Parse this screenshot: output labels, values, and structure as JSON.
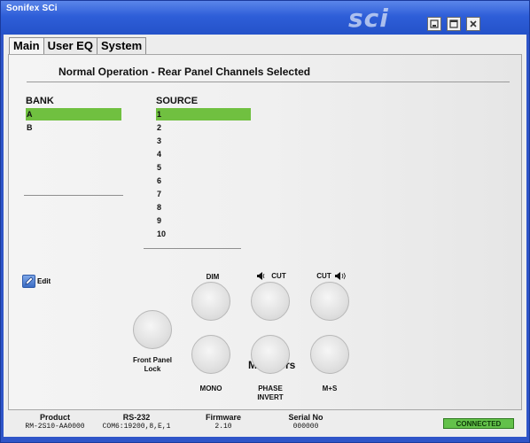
{
  "window": {
    "title": "Sonifex SCi",
    "logo_text": "sci",
    "minimize_label": "",
    "restore_label": "",
    "close_label": ""
  },
  "tabs": [
    {
      "label": "Main",
      "active": true
    },
    {
      "label": "User EQ",
      "active": false
    },
    {
      "label": "System",
      "active": false
    }
  ],
  "main": {
    "heading": "Normal Operation - Rear Panel Channels Selected",
    "bank": {
      "label": "BANK",
      "items": [
        "A",
        "B"
      ],
      "selected": "A"
    },
    "source": {
      "label": "SOURCE",
      "items": [
        "1",
        "2",
        "3",
        "4",
        "5",
        "6",
        "7",
        "8",
        "9",
        "10"
      ],
      "selected": "1"
    },
    "edit_label": "Edit",
    "buttons": {
      "front_panel_lock": "Front Panel Lock",
      "front_panel_lock_line1": "Front Panel",
      "front_panel_lock_line2": "Lock",
      "dim": "DIM",
      "cut_left": "CUT",
      "cut_right": "CUT",
      "mono": "MONO",
      "phase_invert_line1": "PHASE",
      "phase_invert_line2": "INVERT",
      "ms": "M+S"
    },
    "modifiers_label": "Modifiers"
  },
  "status": {
    "product_label": "Product",
    "product_value": "RM-2S10-AA0000",
    "rs232_label": "RS-232",
    "rs232_value": "COM6:19200,8,E,1",
    "firmware_label": "Firmware",
    "firmware_value": "2.10",
    "serial_label": "Serial No",
    "serial_value": "000000",
    "connection": "CONNECTED"
  },
  "colors": {
    "titlebar": "#2e5ed8",
    "selection": "#70c040",
    "connected": "#63c14a",
    "background": "#ededed"
  }
}
